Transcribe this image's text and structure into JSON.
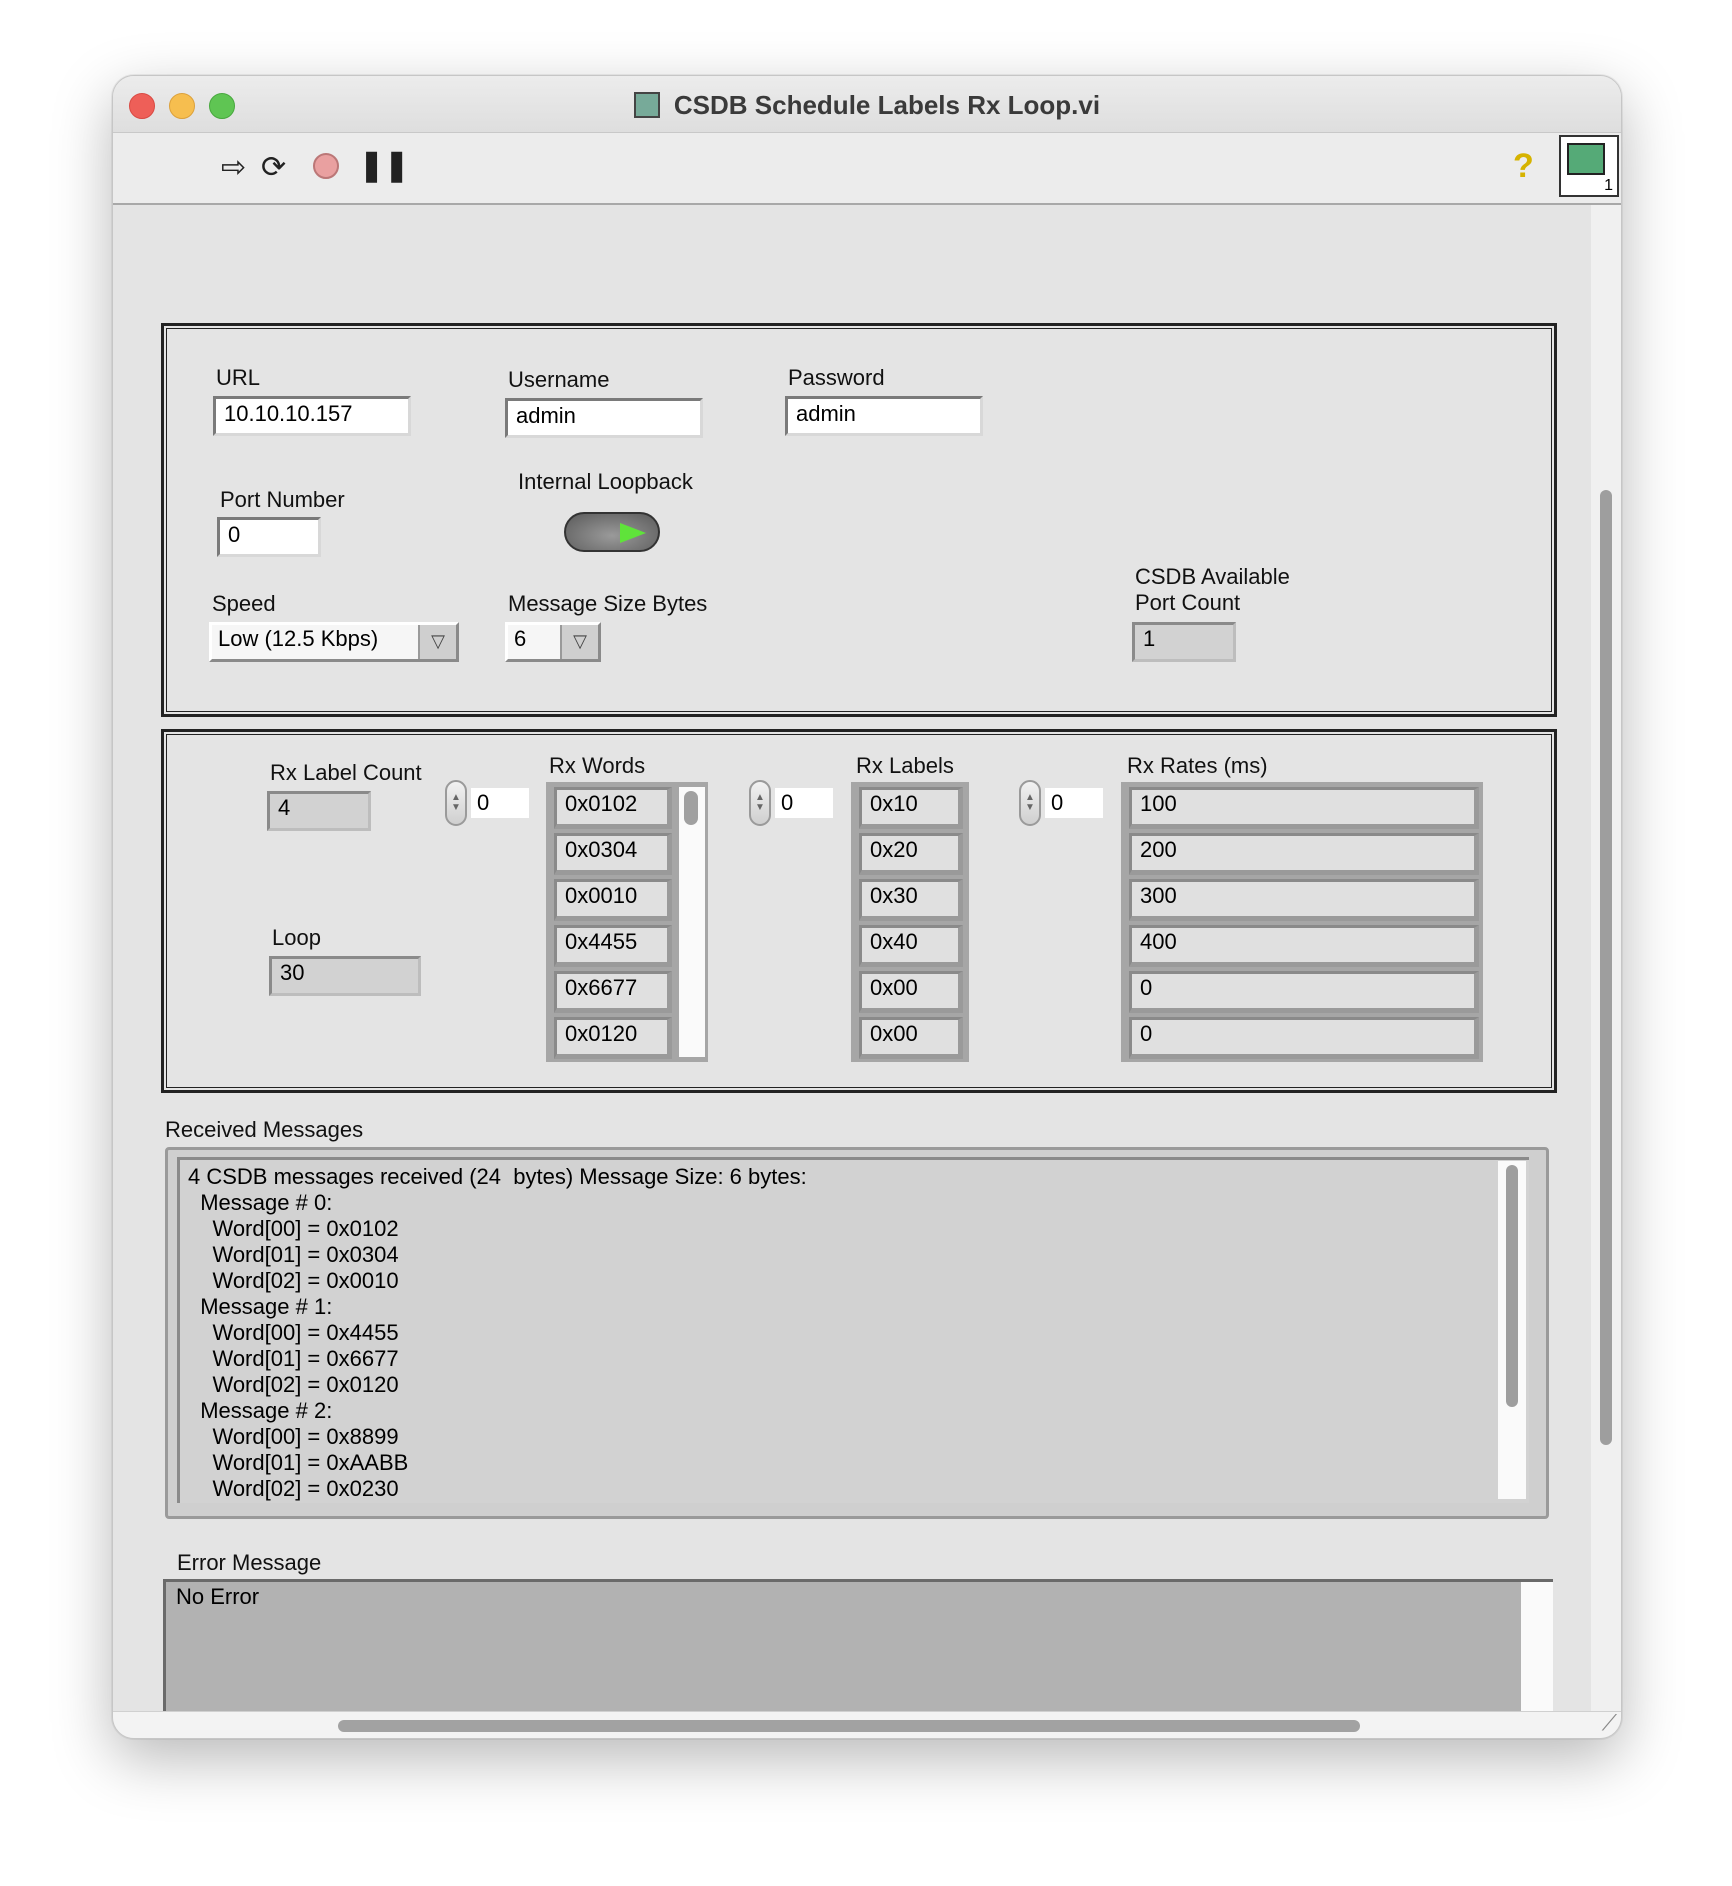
{
  "window": {
    "title": "CSDB Schedule Labels Rx Loop.vi"
  },
  "toolbar": {
    "icons": [
      "run-arrow-icon",
      "run-continuously-icon",
      "abort-icon",
      "pause-icon",
      "help-icon",
      "vi-icon"
    ],
    "vi_icon_number": "1"
  },
  "config": {
    "url_label": "URL",
    "url_value": "10.10.10.157",
    "username_label": "Username",
    "username_value": "admin",
    "password_label": "Password",
    "password_value": "admin",
    "port_label": "Port Number",
    "port_value": "0",
    "loopback_label": "Internal Loopback",
    "speed_label": "Speed",
    "speed_value": "Low (12.5 Kbps)",
    "msgsize_label": "Message Size Bytes",
    "msgsize_value": "6",
    "avail_label_1": "CSDB Available",
    "avail_label_2": "Port Count",
    "avail_value": "1"
  },
  "rx": {
    "label_count_label": "Rx Label Count",
    "label_count_value": "4",
    "loop_label": "Loop",
    "loop_value": "30",
    "words_label": "Rx Words",
    "words_index": "0",
    "words": [
      "0x0102",
      "0x0304",
      "0x0010",
      "0x4455",
      "0x6677",
      "0x0120"
    ],
    "labels_label": "Rx Labels",
    "labels_index": "0",
    "labels": [
      "0x10",
      "0x20",
      "0x30",
      "0x40",
      "0x00",
      "0x00"
    ],
    "rates_label": "Rx Rates (ms)",
    "rates_index": "0",
    "rates": [
      "100",
      "200",
      "300",
      "400",
      "0",
      "0"
    ]
  },
  "received": {
    "label": "Received Messages",
    "lines": [
      "4 CSDB messages received (24  bytes) Message Size: 6 bytes:",
      "  Message # 0:",
      "    Word[00] = 0x0102",
      "    Word[01] = 0x0304",
      "    Word[02] = 0x0010",
      "  Message # 1:",
      "    Word[00] = 0x4455",
      "    Word[01] = 0x6677",
      "    Word[02] = 0x0120",
      "  Message # 2:",
      "    Word[00] = 0x8899",
      "    Word[01] = 0xAABB",
      "    Word[02] = 0x0230"
    ]
  },
  "error": {
    "label": "Error Message",
    "value": "No Error"
  },
  "colors": {
    "close": "#ee5f58",
    "minimize": "#f6be4f",
    "zoom": "#5fc553",
    "panel_bg": "#e4e4e4",
    "led_on": "#5fe33a"
  }
}
